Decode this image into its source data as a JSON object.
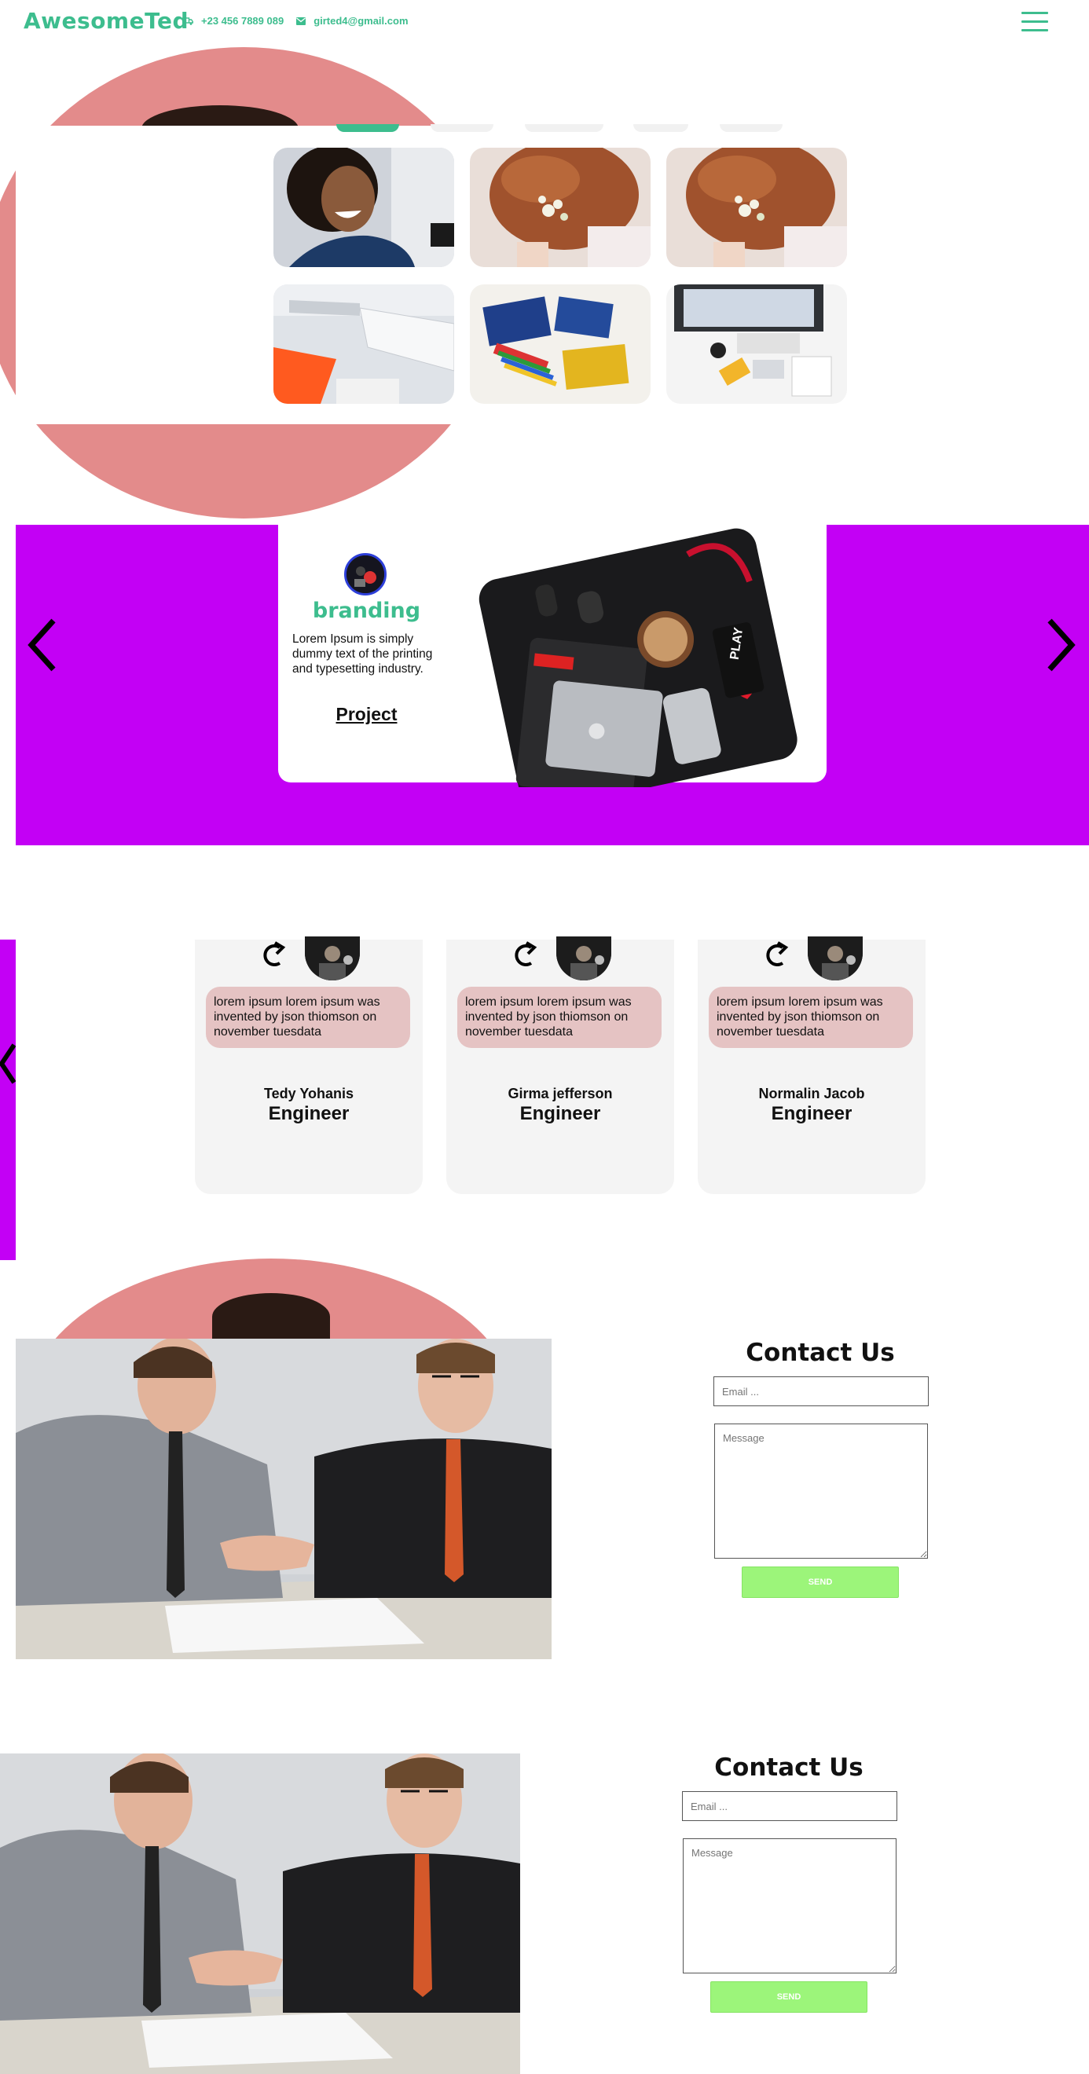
{
  "header": {
    "brand": "AwesomeTed",
    "phone": "+23 456 7889 089",
    "email": "girted4@gmail.com",
    "phone_icon": "truck-icon",
    "email_icon": "mail-icon",
    "menu_icon": "hamburger-menu-icon"
  },
  "colors": {
    "accent": "#3dbd8e",
    "slider_bg": "#c300f5",
    "hero_circle": "#e38b8b",
    "bubble": "#e5c3c3",
    "send_button": "#9cf57a"
  },
  "gallery": {
    "images": [
      "smiling-woman-photo",
      "bride-hair-flowers-photo",
      "bride-hair-flowers-photo",
      "desk-keyboard-branding-photo",
      "arduino-boards-photo",
      "workspace-flatlay-photo"
    ]
  },
  "slider": {
    "title": "branding",
    "text": "Lorem Ipsum is simply dummy text of the printing and typesetting industry.",
    "link": "Project",
    "prev_icon": "chevron-left-icon",
    "next_icon": "chevron-right-icon"
  },
  "testimonials": [
    {
      "quote": "lorem ipsum lorem ipsum was invented by json thiomson on november tuesdata",
      "name": "Tedy Yohanis",
      "role": "Engineer"
    },
    {
      "quote": "lorem ipsum lorem ipsum was invented by json thiomson on november tuesdata",
      "name": "Girma jefferson",
      "role": "Engineer"
    },
    {
      "quote": "lorem ipsum lorem ipsum was invented by json thiomson on november tuesdata",
      "name": "Normalin Jacob",
      "role": "Engineer"
    }
  ],
  "contact": [
    {
      "title": "Contact Us",
      "email_placeholder": "Email ...",
      "message_placeholder": "Message",
      "send": "SEND"
    },
    {
      "title": "Contact Us",
      "email_placeholder": "Email ...",
      "message_placeholder": "Message",
      "send": "SEND"
    }
  ]
}
